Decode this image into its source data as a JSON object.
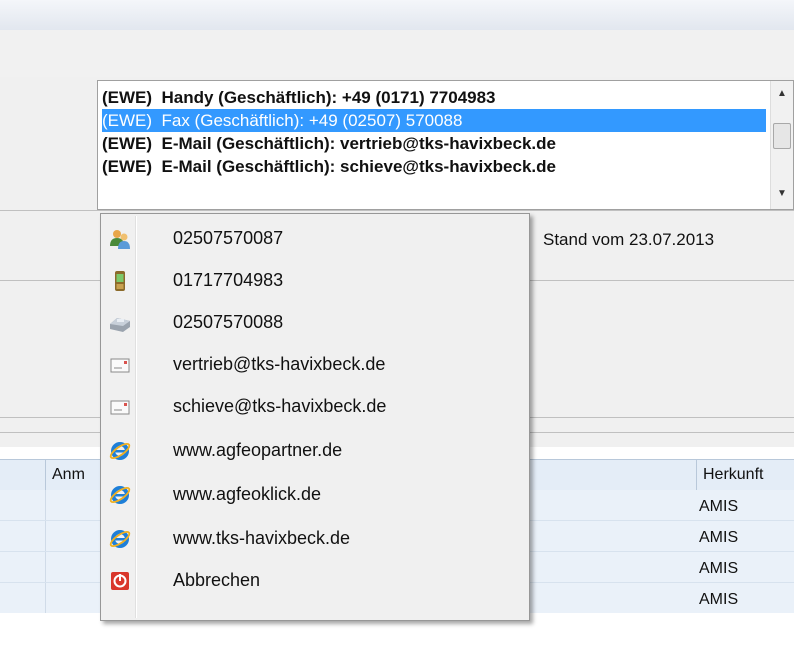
{
  "contact_list": {
    "items": [
      {
        "text": "(EWE)  Handy (Geschäftlich): +49 (0171) 7704983",
        "selected": false
      },
      {
        "text": "(EWE)  Fax (Geschäftlich): +49 (02507) 570088",
        "selected": true
      },
      {
        "text": "(EWE)  E-Mail (Geschäftlich): vertrieb@tks-havixbeck.de",
        "selected": false
      },
      {
        "text": "(EWE)  E-Mail (Geschäftlich): schieve@tks-havixbeck.de",
        "selected": false
      }
    ]
  },
  "status": {
    "stand_text": "Stand vom 23.07.2013"
  },
  "grid": {
    "headers": {
      "anm": "Anm",
      "herkunft": "Herkunft"
    },
    "rows": [
      {
        "herkunft": "AMIS"
      },
      {
        "herkunft": "AMIS"
      },
      {
        "herkunft": "AMIS"
      },
      {
        "herkunft": "AMIS"
      }
    ]
  },
  "context_menu": {
    "items": [
      {
        "label": "02507570087",
        "icon": "contacts-icon"
      },
      {
        "label": "01717704983",
        "icon": "mobile-phone-icon"
      },
      {
        "label": "02507570088",
        "icon": "fax-icon"
      },
      {
        "label": "vertrieb@tks-havixbeck.de",
        "icon": "email-icon"
      },
      {
        "label": "schieve@tks-havixbeck.de",
        "icon": "email-icon"
      },
      {
        "label": "www.agfeopartner.de",
        "icon": "internet-explorer-icon"
      },
      {
        "label": "www.agfeoklick.de",
        "icon": "internet-explorer-icon"
      },
      {
        "label": "www.tks-havixbeck.de",
        "icon": "internet-explorer-icon"
      },
      {
        "label": "Abbrechen",
        "icon": "cancel-icon"
      }
    ]
  },
  "colors": {
    "selection": "#3399ff",
    "grid_header": "#e4edf7",
    "grid_alt_row": "#eaf1f9"
  }
}
